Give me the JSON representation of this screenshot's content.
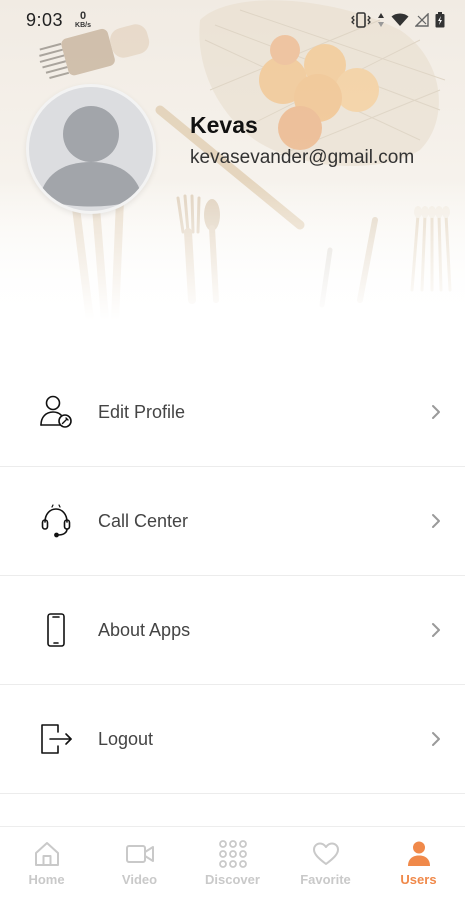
{
  "status_bar": {
    "time": "9:03",
    "speed_value": "0",
    "speed_unit": "KB/s"
  },
  "profile": {
    "name": "Kevas",
    "email": "kevasevander@gmail.com"
  },
  "menu": {
    "items": [
      {
        "label": "Edit Profile",
        "icon": "edit-profile-icon"
      },
      {
        "label": "Call Center",
        "icon": "headset-icon"
      },
      {
        "label": "About Apps",
        "icon": "phone-icon"
      },
      {
        "label": "Logout",
        "icon": "logout-icon"
      }
    ]
  },
  "bottom_nav": {
    "items": [
      {
        "label": "Home",
        "icon": "home-icon"
      },
      {
        "label": "Video",
        "icon": "video-icon"
      },
      {
        "label": "Discover",
        "icon": "grid-icon"
      },
      {
        "label": "Favorite",
        "icon": "heart-icon"
      },
      {
        "label": "Users",
        "icon": "user-icon",
        "active": true
      }
    ]
  },
  "colors": {
    "accent": "#f0894a",
    "nav_inactive": "#c9c9c9",
    "avatar_bg": "#dcdde0"
  }
}
